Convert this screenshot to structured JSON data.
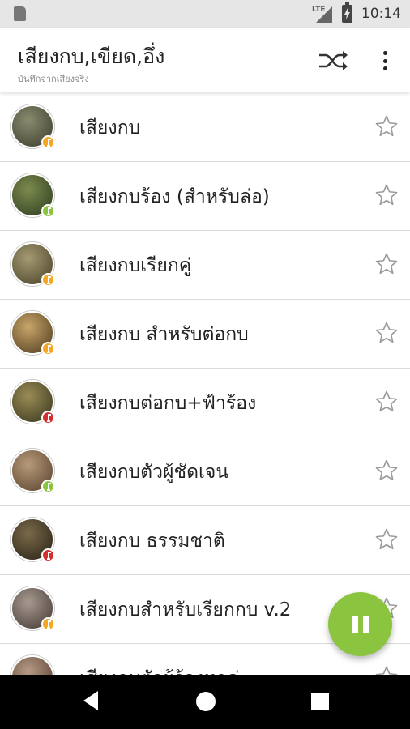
{
  "status_bar": {
    "network": "LTE",
    "time": "10:14"
  },
  "app_bar": {
    "title": "เสียงกบ,เขียด,อึ่ง",
    "subtitle": "บันทึกจากเสียงจริง",
    "shuffle_icon": "shuffle-icon",
    "menu_icon": "more-vert-icon"
  },
  "sounds": [
    {
      "label": "เสียงกบ",
      "badge_color": "#f5a623",
      "thumb_colors": [
        "#8a8a6e",
        "#4d4f3c"
      ]
    },
    {
      "label": "เสียงกบร้อง (สำหรับล่อ)",
      "badge_color": "#8bc53f",
      "thumb_colors": [
        "#7d8a4e",
        "#3f4f2a"
      ]
    },
    {
      "label": "เสียงกบเรียกคู่",
      "badge_color": "#f5a623",
      "thumb_colors": [
        "#a49a72",
        "#5e563a"
      ]
    },
    {
      "label": "เสียงกบ สำหรับต่อกบ",
      "badge_color": "#f5a623",
      "thumb_colors": [
        "#c9a56a",
        "#6b5430"
      ]
    },
    {
      "label": "เสียงกบต่อกบ+ฟ้าร้อง",
      "badge_color": "#d32f2f",
      "thumb_colors": [
        "#9a8c55",
        "#4e4a2b"
      ]
    },
    {
      "label": "เสียงกบตัวผู้ชัดเจน",
      "badge_color": "#8bc53f",
      "thumb_colors": [
        "#b89a7a",
        "#6e5640"
      ]
    },
    {
      "label": "เสียงกบ ธรรมชาติ",
      "badge_color": "#d32f2f",
      "thumb_colors": [
        "#7a6a4a",
        "#3b3222"
      ]
    },
    {
      "label": "เสียงกบสำหรับเรียกกบ v.2",
      "badge_color": "#f5a623",
      "thumb_colors": [
        "#a89a90",
        "#5a4e48"
      ]
    },
    {
      "label": "เสียงกบตัวผู้ร้องหาคู่",
      "badge_color": "#f5a623",
      "thumb_colors": [
        "#b89a86",
        "#6a5244"
      ]
    }
  ],
  "fab": {
    "icon": "pause-icon",
    "color": "#8bc53f"
  },
  "nav_bar": {
    "back_icon": "back-icon",
    "home_icon": "home-icon",
    "recents_icon": "recents-icon"
  }
}
